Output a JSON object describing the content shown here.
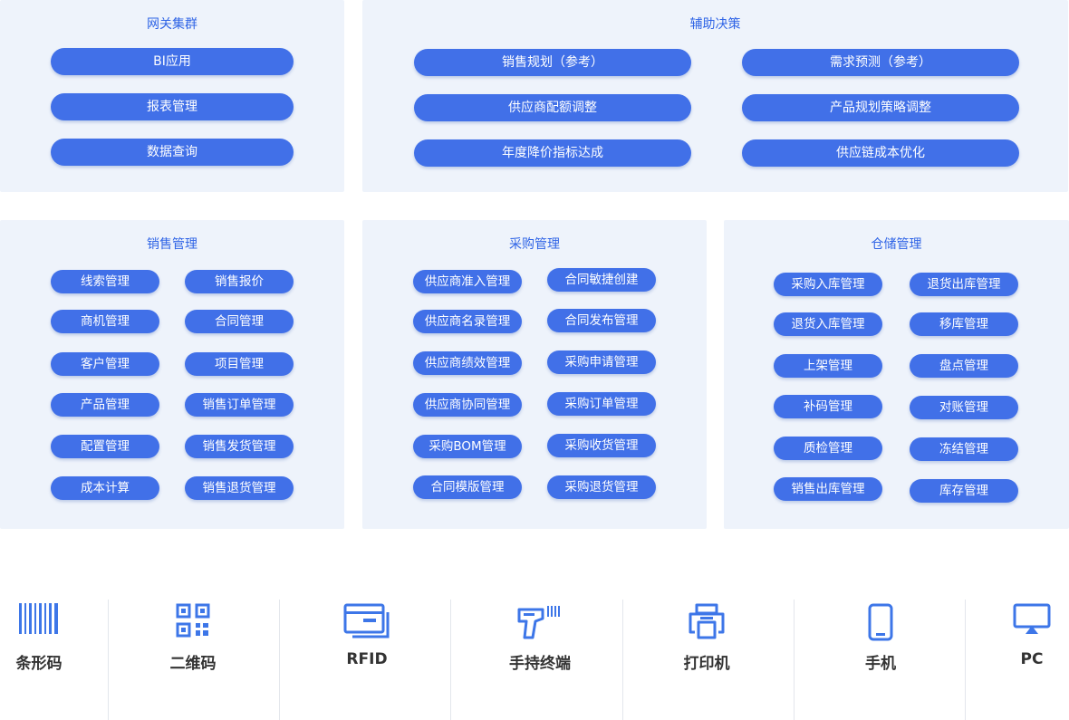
{
  "gateway": {
    "title": "网关集群",
    "items": [
      "BI应用",
      "报表管理",
      "数据查询"
    ]
  },
  "decision": {
    "title": "辅助决策",
    "items": [
      "销售规划（参考）",
      "需求预测（参考）",
      "供应商配额调整",
      "产品规划策略调整",
      "年度降价指标达成",
      "供应链成本优化"
    ]
  },
  "sales": {
    "title": "销售管理",
    "items": [
      "线索管理",
      "销售报价",
      "商机管理",
      "合同管理",
      "客户管理",
      "项目管理",
      "产品管理",
      "销售订单管理",
      "配置管理",
      "销售发货管理",
      "成本计算",
      "销售退货管理"
    ]
  },
  "purchase": {
    "title": "采购管理",
    "items": [
      "供应商准入管理",
      "合同敏捷创建",
      "供应商名录管理",
      "合同发布管理",
      "供应商绩效管理",
      "采购申请管理",
      "供应商协同管理",
      "采购订单管理",
      "采购BOM管理",
      "采购收货管理",
      "合同模版管理",
      "采购退货管理"
    ]
  },
  "warehouse": {
    "title": "仓储管理",
    "items": [
      "采购入库管理",
      "退货出库管理",
      "退货入库管理",
      "移库管理",
      "上架管理",
      "盘点管理",
      "补码管理",
      "对账管理",
      "质检管理",
      "冻结管理",
      "销售出库管理",
      "库存管理"
    ]
  },
  "devices": [
    {
      "label": "条形码",
      "icon": "barcode-icon"
    },
    {
      "label": "二维码",
      "icon": "qrcode-icon"
    },
    {
      "label": "RFID",
      "icon": "rfid-card-icon"
    },
    {
      "label": "手持终端",
      "icon": "handheld-scanner-icon"
    },
    {
      "label": "打印机",
      "icon": "printer-icon"
    },
    {
      "label": "手机",
      "icon": "mobile-phone-icon"
    },
    {
      "label": "PC",
      "icon": "monitor-icon"
    }
  ],
  "colors": {
    "panel_bg": "#eef3fb",
    "pill": "#4170e8",
    "title": "#2f64e6",
    "icon": "#3d76e8",
    "device_label": "#333333"
  }
}
